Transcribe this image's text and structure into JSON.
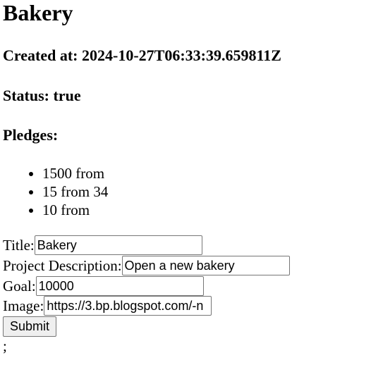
{
  "project": {
    "title": "Bakery",
    "created_at": "Created at: 2024-10-27T06:33:39.659811Z",
    "status": "Status: true",
    "pledges_heading": "Pledges:",
    "pledges": [
      "1500 from",
      "15 from 34",
      "10 from"
    ]
  },
  "form": {
    "title_label": "Title:",
    "title_value": "Bakery",
    "description_label": "Project Description:",
    "description_value": "Open a new bakery",
    "goal_label": "Goal:",
    "goal_value": "10000",
    "image_label": "Image:",
    "image_value": "https://3.bp.blogspot.com/-n",
    "submit_label": "Submit"
  },
  "trailing_text": ";"
}
